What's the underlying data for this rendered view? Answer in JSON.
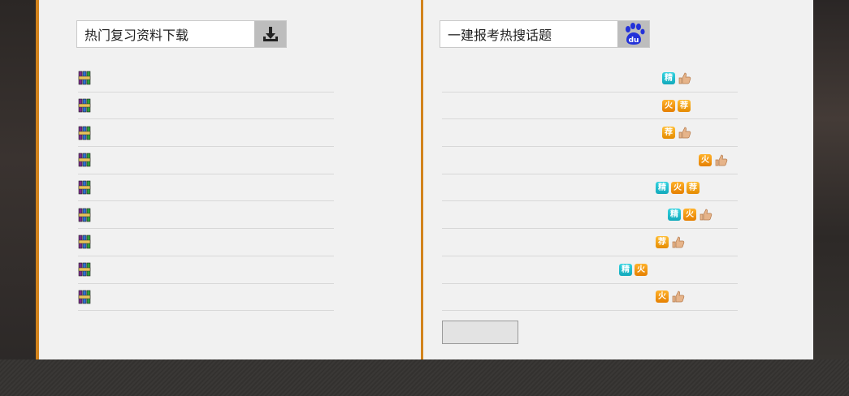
{
  "left": {
    "search": {
      "value": "热门复习资料下载",
      "button_icon": "download-icon"
    },
    "items": [
      {
        "icon": "rar-archive-icon"
      },
      {
        "icon": "rar-archive-icon"
      },
      {
        "icon": "rar-archive-icon"
      },
      {
        "icon": "rar-archive-icon"
      },
      {
        "icon": "rar-archive-icon"
      },
      {
        "icon": "rar-archive-icon"
      },
      {
        "icon": "rar-archive-icon"
      },
      {
        "icon": "rar-archive-icon"
      },
      {
        "icon": "rar-archive-icon"
      }
    ]
  },
  "right": {
    "search": {
      "value": "一建报考热搜话题",
      "button_icon": "baidu-paw-icon",
      "button_text": "du"
    },
    "badge_labels": {
      "jing": "精",
      "huo": "火",
      "jian": "荐"
    },
    "items": [
      {
        "badges": [
          "jing",
          "thumb"
        ]
      },
      {
        "badges": [
          "huo",
          "jian"
        ]
      },
      {
        "badges": [
          "jian",
          "thumb"
        ]
      },
      {
        "badges": [
          "huo",
          "thumb"
        ]
      },
      {
        "badges": [
          "jing",
          "huo",
          "jian"
        ]
      },
      {
        "badges": [
          "jing",
          "huo",
          "thumb"
        ]
      },
      {
        "badges": [
          "jian",
          "thumb"
        ]
      },
      {
        "badges": [
          "jing",
          "huo"
        ]
      },
      {
        "badges": [
          "huo",
          "thumb"
        ]
      }
    ],
    "pager_button": ""
  },
  "colors": {
    "accent": "#d2831c",
    "panel": "#f1f1f1",
    "search_button": "#bdbdbd"
  }
}
